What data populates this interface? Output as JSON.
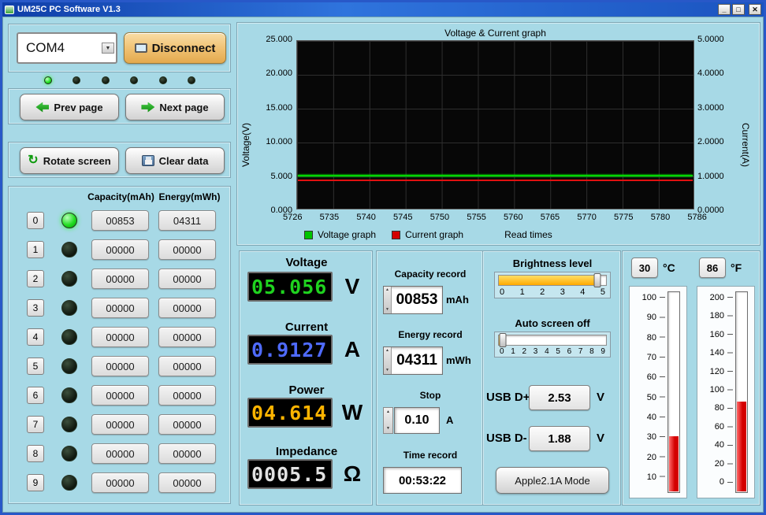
{
  "window": {
    "title": "UM25C PC Software V1.3",
    "buttons": {
      "minimize": "_",
      "maximize": "□",
      "close": "✕"
    }
  },
  "icons": {
    "dropdown": "▼",
    "rotate": "↻",
    "spin_up": "▲",
    "spin_down": "▼"
  },
  "connection": {
    "port": "COM4",
    "disconnect": "Disconnect"
  },
  "pager": {
    "prev": "Prev page",
    "next": "Next page"
  },
  "tools": {
    "rotate": "Rotate screen",
    "clear": "Clear data"
  },
  "table": {
    "capacity_header": "Capacity(mAh)",
    "energy_header": "Energy(mWh)",
    "rows": [
      {
        "index": "0",
        "capacity": "00853",
        "energy": "04311",
        "led": "on"
      },
      {
        "index": "1",
        "capacity": "00000",
        "energy": "00000",
        "led": "off"
      },
      {
        "index": "2",
        "capacity": "00000",
        "energy": "00000",
        "led": "off"
      },
      {
        "index": "3",
        "capacity": "00000",
        "energy": "00000",
        "led": "off"
      },
      {
        "index": "4",
        "capacity": "00000",
        "energy": "00000",
        "led": "off"
      },
      {
        "index": "5",
        "capacity": "00000",
        "energy": "00000",
        "led": "off"
      },
      {
        "index": "6",
        "capacity": "00000",
        "energy": "00000",
        "led": "off"
      },
      {
        "index": "7",
        "capacity": "00000",
        "energy": "00000",
        "led": "off"
      },
      {
        "index": "8",
        "capacity": "00000",
        "energy": "00000",
        "led": "off"
      },
      {
        "index": "9",
        "capacity": "00000",
        "energy": "00000",
        "led": "off"
      }
    ]
  },
  "chart": {
    "title": "Voltage & Current graph",
    "left_axis_label": "Voltage(V)",
    "right_axis_label": "Current(A)",
    "x_axis_label": "Read times",
    "left_ticks": [
      "25.000",
      "20.000",
      "15.000",
      "10.000",
      "5.000",
      "0.000"
    ],
    "right_ticks": [
      "5.0000",
      "4.0000",
      "3.0000",
      "2.0000",
      "1.0000",
      "0.0000"
    ],
    "x_ticks": [
      "5726",
      "5735",
      "5740",
      "5745",
      "5750",
      "5755",
      "5760",
      "5765",
      "5770",
      "5775",
      "5780",
      "5786"
    ],
    "legend": {
      "voltage": "Voltage graph",
      "current": "Current graph"
    }
  },
  "chart_data": {
    "type": "line",
    "title": "Voltage & Current graph",
    "x_label": "Read times",
    "x_range": [
      5726,
      5786
    ],
    "axes": {
      "left": {
        "label": "Voltage(V)",
        "range": [
          0,
          25
        ]
      },
      "right": {
        "label": "Current(A)",
        "range": [
          0,
          5
        ]
      }
    },
    "series": [
      {
        "name": "Voltage graph",
        "color": "#00c400",
        "axis": "left",
        "shape": "flat",
        "value": 5.05
      },
      {
        "name": "Current graph",
        "color": "#d40000",
        "axis": "right",
        "shape": "flat",
        "value": 0.91
      }
    ],
    "grid": true,
    "plot_background": "#000000"
  },
  "meters": {
    "voltage": {
      "label": "Voltage",
      "value": "05.056",
      "unit": "V"
    },
    "current": {
      "label": "Current",
      "value": "0.9127",
      "unit": "A"
    },
    "power": {
      "label": "Power",
      "value": "04.614",
      "unit": "W"
    },
    "impedance": {
      "label": "Impedance",
      "value": "0005.5",
      "unit": "Ω"
    }
  },
  "records": {
    "capacity": {
      "label": "Capacity record",
      "value": "00853",
      "unit": "mAh"
    },
    "energy": {
      "label": "Energy record",
      "value": "04311",
      "unit": "mWh"
    },
    "stop": {
      "label": "Stop",
      "value": "0.10",
      "unit": "A"
    },
    "time": {
      "label": "Time record",
      "value": "00:53:22"
    }
  },
  "settings": {
    "brightness": {
      "label": "Brightness level",
      "value": 4.6,
      "min": 0,
      "max": 5,
      "ticks": [
        "0",
        "1",
        "2",
        "3",
        "4",
        "5"
      ]
    },
    "auto_screen_off": {
      "label": "Auto screen off",
      "value": 0,
      "min": 0,
      "max": 9,
      "ticks": [
        "0",
        "1",
        "2",
        "3",
        "4",
        "5",
        "6",
        "7",
        "8",
        "9"
      ]
    },
    "usb_dp": {
      "label": "USB D+",
      "value": "2.53",
      "unit": "V"
    },
    "usb_dm": {
      "label": "USB D-",
      "value": "1.88",
      "unit": "V"
    },
    "mode_button": "Apple2.1A Mode"
  },
  "thermometers": {
    "celsius": {
      "value": "30",
      "unit": "°C",
      "scale": [
        "100",
        "90",
        "80",
        "70",
        "60",
        "50",
        "40",
        "30",
        "20",
        "10"
      ]
    },
    "fahrenheit": {
      "value": "86",
      "unit": "°F",
      "scale": [
        "200",
        "180",
        "160",
        "140",
        "120",
        "100",
        "80",
        "60",
        "40",
        "20",
        "0"
      ]
    }
  }
}
